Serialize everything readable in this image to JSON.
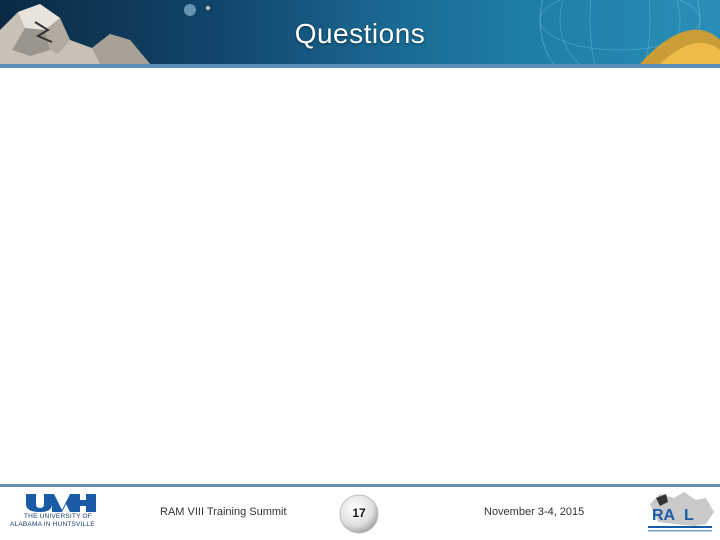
{
  "slide": {
    "title": "Questions"
  },
  "footer": {
    "event": "RAM VIII Training Summit",
    "page_number": "17",
    "date": "November 3-4, 2015"
  },
  "logos": {
    "uah_line1": "THE UNIVERSITY OF",
    "uah_line2": "ALABAMA IN HUNTSVILLE",
    "uah_icon": "uah-logo",
    "ram_icon": "rmal-logo"
  },
  "colors": {
    "header_dark": "#0a2a44",
    "header_light": "#2a8fb8",
    "rule": "#6b8fb3",
    "brand_blue": "#1a3b6e"
  }
}
